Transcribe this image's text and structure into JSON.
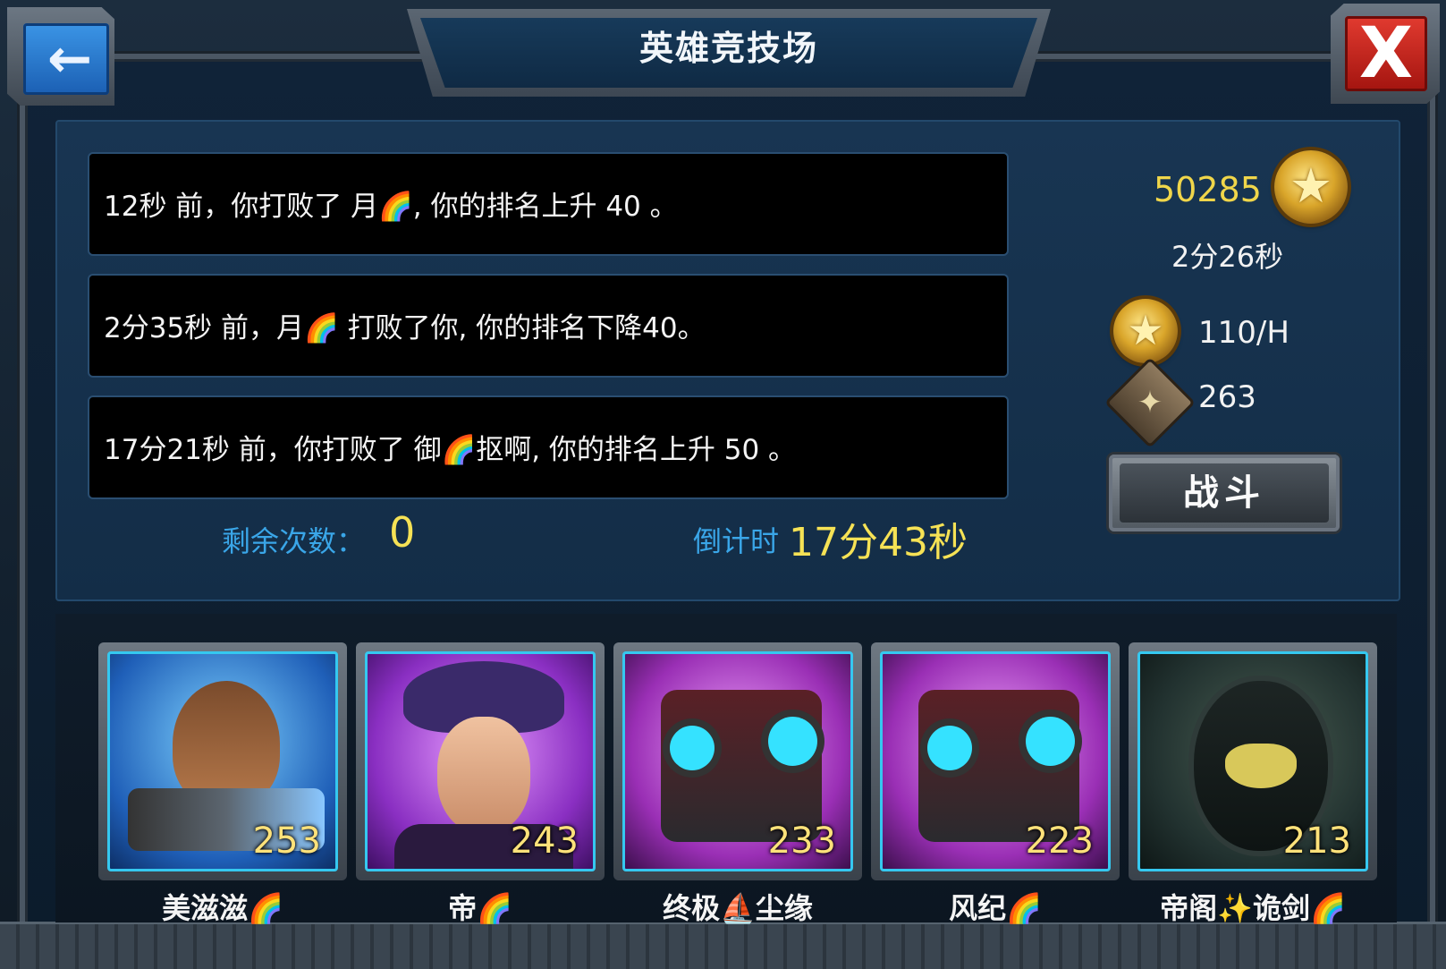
{
  "header": {
    "title": "英雄竞技场",
    "back_icon": "←",
    "close_icon": "X"
  },
  "battle_log": [
    {
      "text": "12秒 前，你打败了 月🌈, 你的排名上升 40 。"
    },
    {
      "text": "2分35秒 前，月🌈 打败了你, 你的排名下降40。"
    },
    {
      "text": "17分21秒 前，你打败了 御🌈抠啊, 你的排名上升 50 。"
    }
  ],
  "remaining": {
    "label": "剩余次数：",
    "value": "0"
  },
  "countdown": {
    "label": "倒计时",
    "value": "17分43秒"
  },
  "stats": {
    "score": "50285",
    "rank_time": "2分26秒",
    "rate": "110/H",
    "badge_count": "263",
    "medal_icon": "★",
    "badge_icon": "✦"
  },
  "battle_button": {
    "label": "战斗"
  },
  "heroes": [
    {
      "name": "美滋滋🌈",
      "level": "253",
      "bg": "#1f5fb8"
    },
    {
      "name": "帝🌈",
      "level": "243",
      "bg": "#8a2fc2"
    },
    {
      "name": "终极⛵尘缘",
      "level": "233",
      "bg": "#9a2fb5"
    },
    {
      "name": "风纪🌈",
      "level": "223",
      "bg": "#9a2fb5"
    },
    {
      "name": "帝阁✨诡剑🌈",
      "level": "213",
      "bg": "#2a3b3a"
    }
  ],
  "colors": {
    "accent_blue": "#3aa6e8",
    "gold": "#f6e255",
    "close_red": "#c9241b"
  }
}
